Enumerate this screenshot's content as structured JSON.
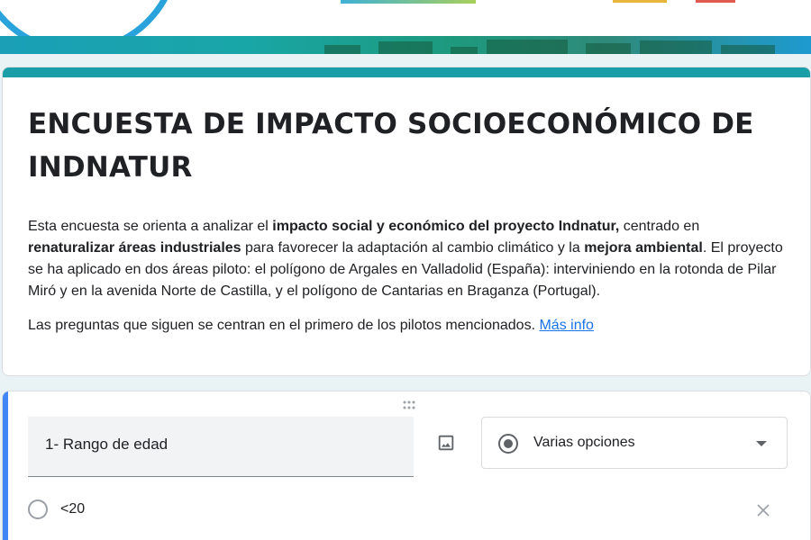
{
  "form": {
    "title": "ENCUESTA DE IMPACTO SOCIOECONÓMICO DE INDNATUR",
    "description": {
      "p1_a": "Esta encuesta se orienta a analizar el ",
      "p1_b": "impacto social y económico del proyecto Indnatur,",
      "p1_c": " centrado en ",
      "p1_d": "renaturalizar áreas industriales",
      "p1_e": " para favorecer la adaptación al cambio climático y la ",
      "p1_f": "mejora ambiental",
      "p1_g": ". El proyecto se ha aplicado en dos áreas piloto: el polígono de Argales en Valladolid (España): interviniendo en la rotonda de Pilar Miró y en la avenida Norte de Castilla, y el polígono de Cantarias en Braganza (Portugal).",
      "p2": "Las preguntas que siguen se centran en el primero de los pilotos mencionados. ",
      "more_info_link": "Más info"
    }
  },
  "question": {
    "title": "1- Rango de edad",
    "type_label": "Varias opciones",
    "options": [
      {
        "label": "<20"
      }
    ]
  },
  "colors": {
    "title_accent": "#1a9fa8",
    "question_accent": "#4285f4",
    "link": "#1a73e8",
    "banner_circle": "#2aa3dd"
  },
  "icons": {
    "image": "image-icon",
    "radio": "radio-checked-icon",
    "dropdown": "chevron-down-icon",
    "remove": "close-icon",
    "drag": "drag-handle-icon"
  }
}
